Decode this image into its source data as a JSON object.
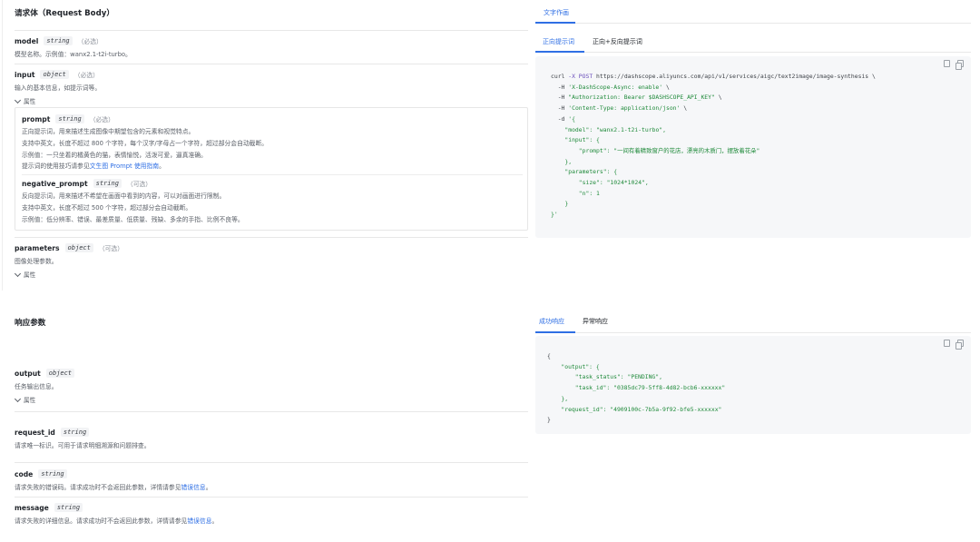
{
  "request": {
    "title": "请求体（Request Body）",
    "model": {
      "name": "model",
      "type": "string",
      "req": "（必选）",
      "desc": "模型名称。示例值：wanx2.1-t2i-turbo。"
    },
    "input": {
      "name": "input",
      "type": "object",
      "req": "（必选）",
      "desc": "输入的基本信息，如提示词等。",
      "attr_label": "属性"
    },
    "prompt": {
      "name": "prompt",
      "type": "string",
      "req": "（必选）",
      "lines": [
        "正向提示词，用来描述生成图像中期望包含的元素和视觉特点。",
        "支持中英文，长度不超过 800 个字符，每个汉字/字母占一个字符，超过部分会自动截断。",
        "示例值：一只坐着的橘黄色的猫，表情愉悦，活泼可爱，逼真准确。"
      ],
      "tip_prefix": "提示词的使用技巧请参见",
      "tip_link": "文生图 Prompt 使用指南",
      "tip_suffix": "。"
    },
    "negative_prompt": {
      "name": "negative_prompt",
      "type": "string",
      "req": "（可选）",
      "lines": [
        "反向提示词，用来描述不希望在画面中看到的内容，可以对画面进行限制。",
        "支持中英文，长度不超过 500 个字符，超过部分会自动截断。",
        "示例值：低分辨率、错误、最差质量、低质量、残缺、多余的手指、比例不良等。"
      ]
    },
    "parameters": {
      "name": "parameters",
      "type": "object",
      "req": "（可选）",
      "desc": "图像处理参数。",
      "attr_label": "属性"
    }
  },
  "response": {
    "title": "响应参数",
    "output": {
      "name": "output",
      "type": "object",
      "desc": "任务输出信息。",
      "attr_label": "属性"
    },
    "request_id": {
      "name": "request_id",
      "type": "string",
      "desc": "请求唯一标识。可用于请求明细溯源和问题排查。"
    },
    "code": {
      "name": "code",
      "type": "string",
      "desc_prefix": "请求失败的错误码。请求成功时不会返回此参数，详情请参见",
      "desc_link": "错误信息",
      "desc_suffix": "。"
    },
    "message": {
      "name": "message",
      "type": "string",
      "desc_prefix": "请求失败的详细信息。请求成功时不会返回此参数，详情请参见",
      "desc_link": "错误信息",
      "desc_suffix": "。"
    }
  },
  "right_top": {
    "main_tab": "文字作画",
    "sub_tabs": [
      "正向提示词",
      "正向+反向提示词"
    ],
    "code": {
      "l1a": "curl ",
      "l1b": "-X POST",
      "l1c": " https://dashscope.aliyuncs.com/api/v1/services/aigc/text2image/image-synthesis \\",
      "l2a": "  -H ",
      "l2b": "'X-DashScope-Async: enable'",
      "l2c": " \\",
      "l3a": "  -H ",
      "l3b": "\"Authorization: Bearer $DASHSCOPE_API_KEY\"",
      "l3c": " \\",
      "l4a": "  -H ",
      "l4b": "'Content-Type: application/json'",
      "l4c": " \\",
      "l5a": "  -d ",
      "l5b": "'{",
      "l6a": "    \"model\": ",
      "l6b": "\"wanx2.1-t2i-turbo\"",
      "l6c": ",",
      "l7": "    \"input\": {",
      "l8a": "        \"prompt\": ",
      "l8b": "\"一间有着精致窗户的花店，漂亮的木质门，摆放着花朵\"",
      "l9": "    },",
      "l10": "    \"parameters\": {",
      "l11a": "        \"size\": ",
      "l11b": "\"1024*1024\"",
      "l11c": ",",
      "l12a": "        \"n\": ",
      "l12b": "1",
      "l13": "    }",
      "l14": "}'"
    }
  },
  "right_bottom": {
    "tabs": [
      "成功响应",
      "异常响应"
    ],
    "code": {
      "l1": "{",
      "l2": "    \"output\": {",
      "l3a": "        \"task_status\": ",
      "l3b": "\"PENDING\"",
      "l3c": ",",
      "l4a": "        \"task_id\": ",
      "l4b": "\"0385dc79-5ff8-4d82-bcb6-xxxxxx\"",
      "l5": "    },",
      "l6a": "    \"request_id\": ",
      "l6b": "\"4909100c-7b5a-9f92-bfe5-xxxxxx\"",
      "l7": "}"
    }
  },
  "icons": [
    "copy-icon",
    "file-icon",
    "chevron-down-icon"
  ]
}
